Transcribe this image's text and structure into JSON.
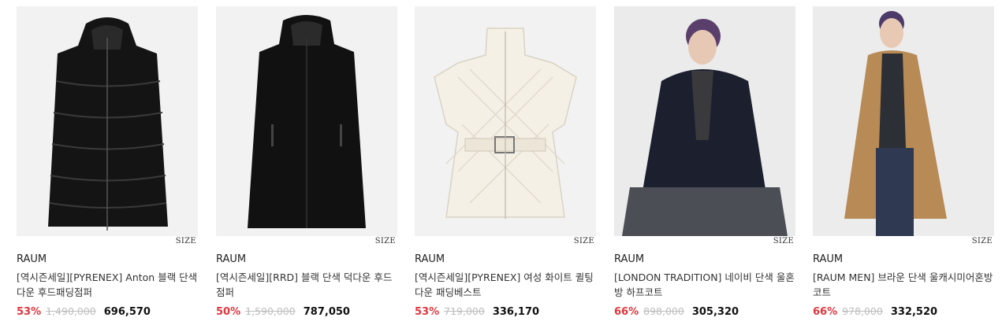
{
  "products": [
    {
      "image": "black-hooded-long-puffer-photo",
      "size_label": "SIZE",
      "brand": "RAUM",
      "name": "[역시즌세일][PYRENEX] Anton 블랙 단색 다운 후드패딩점퍼",
      "discount": "53%",
      "original_price": "1,490,000",
      "sale_price": "696,570"
    },
    {
      "image": "black-hooded-down-coat-photo",
      "size_label": "SIZE",
      "brand": "RAUM",
      "name": "[역시즌세일][RRD] 블랙 단색 덕다운 후드점퍼",
      "discount": "50%",
      "original_price": "1,590,000",
      "sale_price": "787,050"
    },
    {
      "image": "white-quilted-belted-vest-photo",
      "size_label": "SIZE",
      "brand": "RAUM",
      "name": "[역시즌세일][PYRENEX] 여성 화이트 퀼팅 다운 패딩베스트",
      "discount": "53%",
      "original_price": "719,000",
      "sale_price": "336,170"
    },
    {
      "image": "navy-half-coat-model-photo",
      "size_label": "SIZE",
      "brand": "RAUM",
      "name": "[LONDON TRADITION] 네이비 단색 울혼방 하프코트",
      "discount": "66%",
      "original_price": "898,000",
      "sale_price": "305,320"
    },
    {
      "image": "camel-long-wool-coat-model-photo",
      "size_label": "SIZE",
      "brand": "RAUM",
      "name": "[RAUM MEN] 브라운 단색 울캐시미어혼방 코트",
      "discount": "66%",
      "original_price": "978,000",
      "sale_price": "332,520"
    }
  ],
  "colors": {
    "discount": "#e0363d",
    "original_price": "#bdbdbd"
  }
}
